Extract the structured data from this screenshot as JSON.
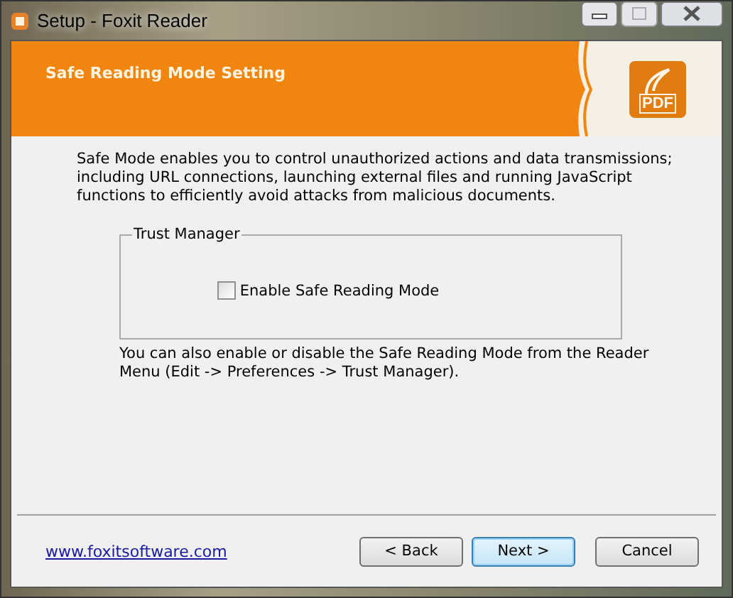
{
  "window": {
    "title": "Setup - Foxit Reader"
  },
  "header": {
    "title": "Safe Reading Mode Setting",
    "logo_text": "PDF"
  },
  "intro": "Safe Mode enables you to control unauthorized actions and data transmissions; including URL connections, launching external files and running JavaScript functions to efficiently avoid attacks from malicious documents.",
  "group": {
    "title": "Trust Manager",
    "checkbox": {
      "label": "Enable Safe Reading Mode",
      "checked": false
    }
  },
  "note": "You can also enable or disable the Safe Reading Mode from the Reader Menu (Edit -> Preferences -> Trust Manager).",
  "link": "www.foxitsoftware.com",
  "buttons": [
    {
      "label": "< Back",
      "default": false
    },
    {
      "label": "Next >",
      "default": true
    },
    {
      "label": "Cancel",
      "default": false
    }
  ]
}
